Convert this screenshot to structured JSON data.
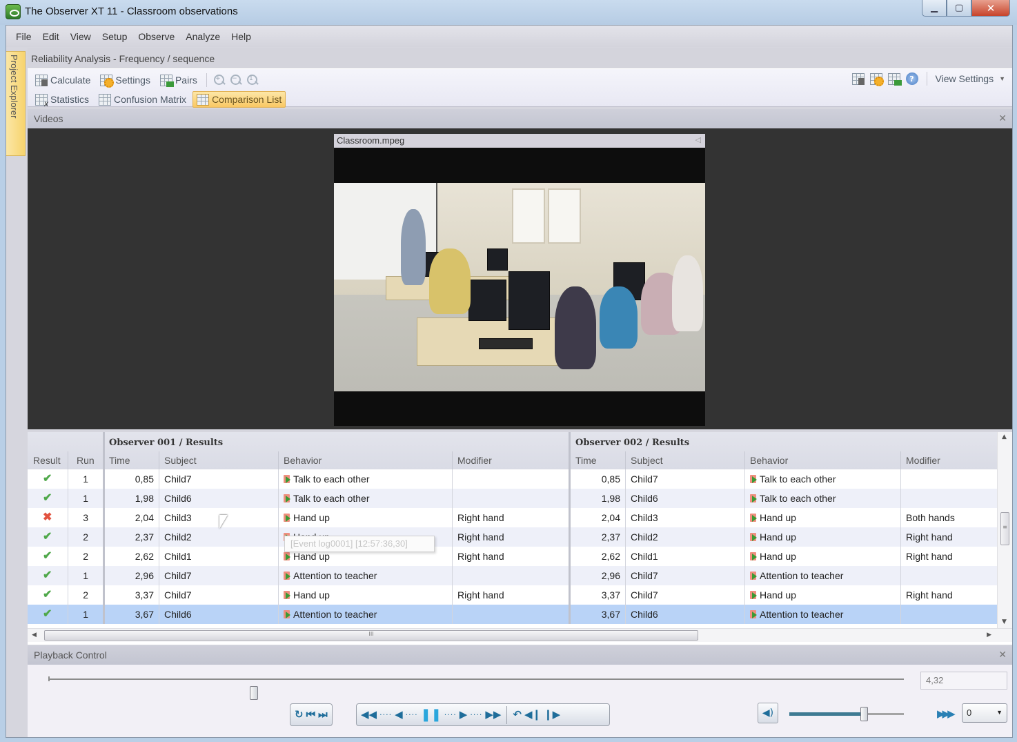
{
  "window": {
    "title": "The Observer XT 11 - Classroom observations",
    "controls": [
      "minimize",
      "maximize",
      "close"
    ]
  },
  "menu": [
    "File",
    "Edit",
    "View",
    "Setup",
    "Observe",
    "Analyze",
    "Help"
  ],
  "project_explorer_label": "Project Explorer",
  "document": {
    "title": "Reliability Analysis - Frequency / sequence"
  },
  "toolbar": {
    "row1": [
      {
        "label": "Calculate",
        "icon": "calculate-icon"
      },
      {
        "label": "Settings",
        "icon": "settings-icon"
      },
      {
        "label": "Pairs",
        "icon": "pairs-icon"
      }
    ],
    "zoom_icons": [
      "zoom-in-icon",
      "zoom-out-icon",
      "zoom-reset-icon"
    ],
    "row2": [
      {
        "label": "Statistics",
        "icon": "statistics-icon"
      },
      {
        "label": "Confusion Matrix",
        "icon": "confusion-matrix-icon"
      },
      {
        "label": "Comparison List",
        "icon": "comparison-list-icon",
        "active": true
      }
    ],
    "right_icons": [
      "layout-icon",
      "open-layout-icon",
      "export-icon",
      "help-icon"
    ],
    "view_settings_label": "View Settings"
  },
  "videos_panel": {
    "title": "Videos",
    "video": {
      "filename": "Classroom.mpeg"
    }
  },
  "comparison": {
    "observer1_title": "Observer 001 / Results",
    "observer2_title": "Observer 002 / Results",
    "columns": {
      "result": "Result",
      "run": "Run",
      "time": "Time",
      "subject": "Subject",
      "behavior": "Behavior",
      "modifier": "Modifier"
    },
    "rows": [
      {
        "result": "match",
        "run": "1",
        "o1": {
          "time": "0,85",
          "subject": "Child7",
          "behavior": "Talk to each other",
          "modifier": ""
        },
        "o2": {
          "time": "0,85",
          "subject": "Child7",
          "behavior": "Talk to each other",
          "modifier": ""
        }
      },
      {
        "result": "match",
        "run": "1",
        "o1": {
          "time": "1,98",
          "subject": "Child6",
          "behavior": "Talk to each other",
          "modifier": ""
        },
        "o2": {
          "time": "1,98",
          "subject": "Child6",
          "behavior": "Talk to each other",
          "modifier": ""
        }
      },
      {
        "result": "mismatch",
        "run": "3",
        "o1": {
          "time": "2,04",
          "subject": "Child3",
          "behavior": "Hand up",
          "modifier": "Right hand"
        },
        "o2": {
          "time": "2,04",
          "subject": "Child3",
          "behavior": "Hand up",
          "modifier": "Both hands"
        }
      },
      {
        "result": "match",
        "run": "2",
        "o1": {
          "time": "2,37",
          "subject": "Child2",
          "behavior": "Hand up",
          "modifier": "Right hand"
        },
        "o2": {
          "time": "2,37",
          "subject": "Child2",
          "behavior": "Hand up",
          "modifier": "Right hand"
        }
      },
      {
        "result": "match",
        "run": "2",
        "o1": {
          "time": "2,62",
          "subject": "Child1",
          "behavior": "Hand up",
          "modifier": "Right hand"
        },
        "o2": {
          "time": "2,62",
          "subject": "Child1",
          "behavior": "Hand up",
          "modifier": "Right hand"
        }
      },
      {
        "result": "match",
        "run": "1",
        "o1": {
          "time": "2,96",
          "subject": "Child7",
          "behavior": "Attention to teacher",
          "modifier": ""
        },
        "o2": {
          "time": "2,96",
          "subject": "Child7",
          "behavior": "Attention to teacher",
          "modifier": ""
        }
      },
      {
        "result": "match",
        "run": "2",
        "o1": {
          "time": "3,37",
          "subject": "Child7",
          "behavior": "Hand up",
          "modifier": "Right hand"
        },
        "o2": {
          "time": "3,37",
          "subject": "Child7",
          "behavior": "Hand up",
          "modifier": "Right hand"
        }
      },
      {
        "result": "match",
        "run": "1",
        "o1": {
          "time": "3,67",
          "subject": "Child6",
          "behavior": "Attention to teacher",
          "modifier": ""
        },
        "o2": {
          "time": "3,67",
          "subject": "Child6",
          "behavior": "Attention to teacher",
          "modifier": ""
        },
        "selected": true
      }
    ],
    "tooltip": "[Event log0001] [12:57:36,30]",
    "result_colors": {
      "match": "#4fa84a",
      "mismatch": "#e2523f"
    }
  },
  "playback": {
    "title": "Playback Control",
    "current_time": "4,32",
    "timeline_position": 0.24,
    "volume_level": 0.65,
    "speed_value": "0",
    "buttons": {
      "group1": [
        "loop-icon",
        "previous-observation-icon",
        "next-observation-icon"
      ],
      "group2": [
        "fast-rewind-icon",
        "step-back-icon",
        "pause-icon",
        "play-icon",
        "fast-forward-icon"
      ],
      "group3": [
        "undo-icon",
        "previous-frame-icon",
        "next-frame-icon"
      ]
    }
  },
  "colors": {
    "accent_active": "#f9c863",
    "selection": "#b9d3f7",
    "playback_blue": "#1e6d9a"
  }
}
